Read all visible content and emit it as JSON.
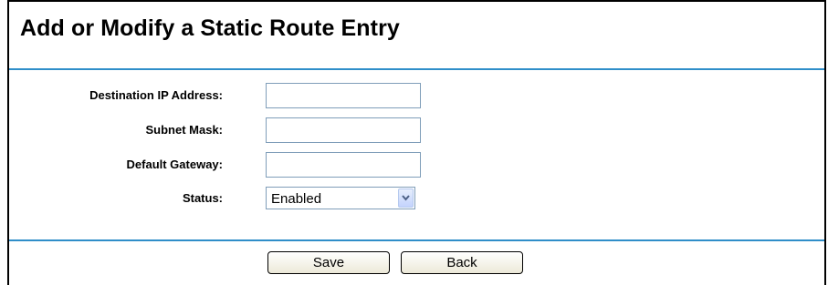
{
  "page": {
    "title": "Add or Modify a Static Route Entry"
  },
  "form": {
    "destination_ip": {
      "label": "Destination IP Address:",
      "value": ""
    },
    "subnet_mask": {
      "label": "Subnet Mask:",
      "value": ""
    },
    "default_gateway": {
      "label": "Default Gateway:",
      "value": ""
    },
    "status": {
      "label": "Status:",
      "selected": "Enabled"
    }
  },
  "actions": {
    "save_label": "Save",
    "back_label": "Back"
  },
  "colors": {
    "divider": "#2f8ec9",
    "input_border": "#7f9db9"
  },
  "icons": {
    "dropdown": "chevron-down-icon"
  }
}
